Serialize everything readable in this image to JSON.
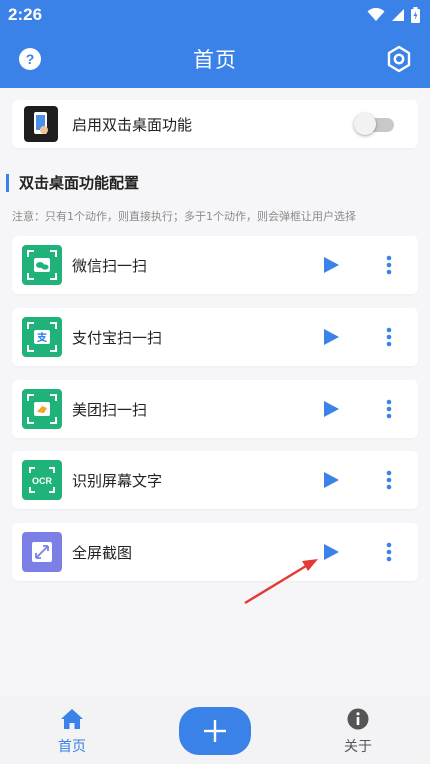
{
  "status_bar": {
    "time": "2:26"
  },
  "app_bar": {
    "title": "首页"
  },
  "toggle_card": {
    "label": "启用双击桌面功能",
    "enabled": false
  },
  "section": {
    "title": "双击桌面功能配置",
    "note": "注意：只有1个动作，则直接执行；多于1个动作，则会弹框让用户选择"
  },
  "actions": [
    {
      "label": "微信扫一扫",
      "icon": "wechat-scan-icon",
      "color": "#1fb37a"
    },
    {
      "label": "支付宝扫一扫",
      "icon": "alipay-scan-icon",
      "color": "#1fb37a"
    },
    {
      "label": "美团扫一扫",
      "icon": "meituan-scan-icon",
      "color": "#1fb37a"
    },
    {
      "label": "识别屏幕文字",
      "icon": "ocr-icon",
      "color": "#1fb37a",
      "icon_text": "OCR"
    },
    {
      "label": "全屏截图",
      "icon": "fullscreen-screenshot-icon",
      "color": "#7b7fe6"
    }
  ],
  "bottom_nav": {
    "home_label": "首页",
    "about_label": "关于"
  },
  "colors": {
    "primary": "#3a82e8",
    "annotation_arrow": "#e53935"
  }
}
